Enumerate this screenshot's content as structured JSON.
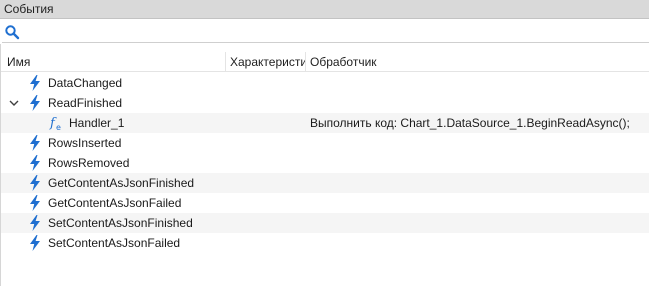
{
  "panel": {
    "title": "События"
  },
  "search": {
    "value": "",
    "placeholder": ""
  },
  "columns": {
    "name": "Имя",
    "characteristic": "Характеристи",
    "handler": "Обработчик"
  },
  "events": [
    {
      "name": "DataChanged"
    },
    {
      "name": "ReadFinished",
      "expanded": true,
      "handler": {
        "name": "Handler_1",
        "action": "Выполнить код: Chart_1.DataSource_1.BeginReadAsync();"
      }
    },
    {
      "name": "RowsInserted"
    },
    {
      "name": "RowsRemoved"
    },
    {
      "name": "GetContentAsJsonFinished"
    },
    {
      "name": "GetContentAsJsonFailed"
    },
    {
      "name": "SetContentAsJsonFinished"
    },
    {
      "name": "SetContentAsJsonFailed"
    }
  ],
  "colors": {
    "bolt": "#1f6fd0",
    "header_bg": "#d9d9d9",
    "alt_row": "#f5f5f5"
  },
  "icons": {
    "search": "search-icon",
    "event": "lightning-bolt-icon",
    "handler": "function-icon",
    "expander": "chevron-down-icon"
  }
}
